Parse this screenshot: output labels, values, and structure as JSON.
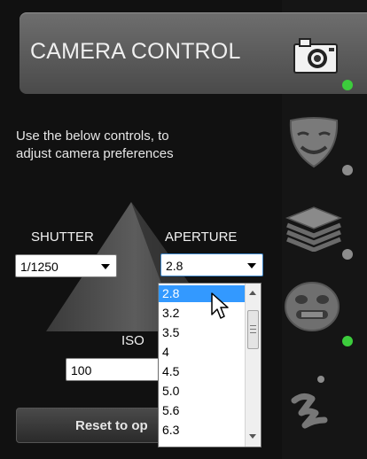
{
  "header": {
    "title": "CAMERA CONTROL",
    "icon": "camera-icon"
  },
  "instructions": {
    "line1": "Use the below controls, to",
    "line2": "adjust camera preferences"
  },
  "controls": {
    "shutter": {
      "label": "SHUTTER",
      "value": "1/1250"
    },
    "aperture": {
      "label": "APERTURE",
      "value": "2.8",
      "options": [
        "2.8",
        "3.2",
        "3.5",
        "4",
        "4.5",
        "5.0",
        "5.6",
        "6.3"
      ],
      "highlighted": "2.8"
    },
    "iso": {
      "label": "ISO",
      "value": "100"
    }
  },
  "reset_button": {
    "label": "Reset to op"
  },
  "rail": [
    {
      "icon": "camera-icon",
      "status": "green"
    },
    {
      "icon": "masks-icon",
      "status": "gray"
    },
    {
      "icon": "layers-icon",
      "status": "gray"
    },
    {
      "icon": "face-icon",
      "status": "green"
    },
    {
      "icon": "brush-icon",
      "status": "gray"
    }
  ],
  "colors": {
    "background": "#111111",
    "header": "#5a5a5a",
    "highlight": "#3399ff",
    "status_green": "#3ccc3c",
    "status_gray": "#8c8c8c"
  }
}
